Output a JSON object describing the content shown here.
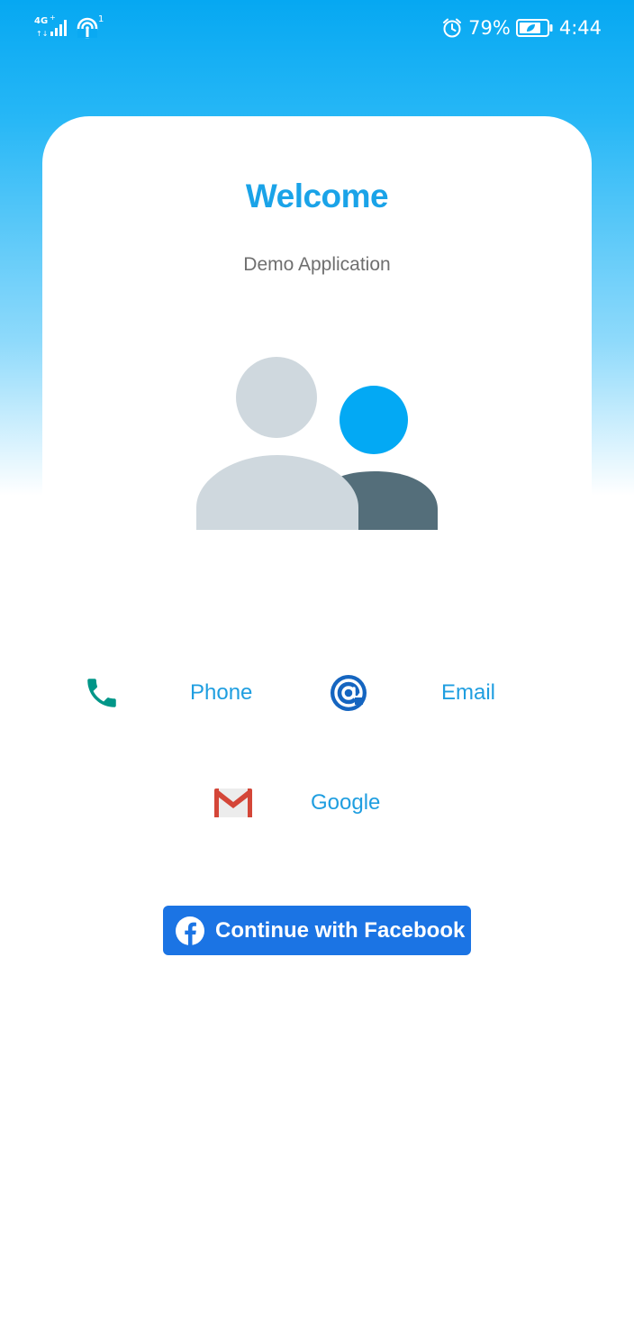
{
  "status_bar": {
    "network": "4G",
    "hotspot_badge": "1",
    "battery_percent": "79%",
    "time": "4:44",
    "icons": [
      "signal-icon",
      "hotspot-icon",
      "alarm-icon",
      "battery-icon"
    ]
  },
  "header": {
    "title": "Welcome",
    "subtitle": "Demo Application"
  },
  "illustration": {
    "icon": "users-icon",
    "colors": {
      "back_person": "#cfd8de",
      "front_head": "#03a9f4",
      "front_body": "#546e7a"
    }
  },
  "login_options": [
    {
      "id": "phone",
      "label": "Phone",
      "icon": "phone-icon",
      "color": "#009688"
    },
    {
      "id": "email",
      "label": "Email",
      "icon": "at-sign-icon",
      "color": "#1565c0"
    },
    {
      "id": "google",
      "label": "Google",
      "icon": "gmail-icon",
      "color": "#d44638"
    }
  ],
  "facebook_button": {
    "label": "Continue with Facebook",
    "icon": "facebook-icon",
    "color": "#1b74e4"
  },
  "colors": {
    "accent": "#1aa3e8",
    "gradient_top": "#06a8f2"
  }
}
